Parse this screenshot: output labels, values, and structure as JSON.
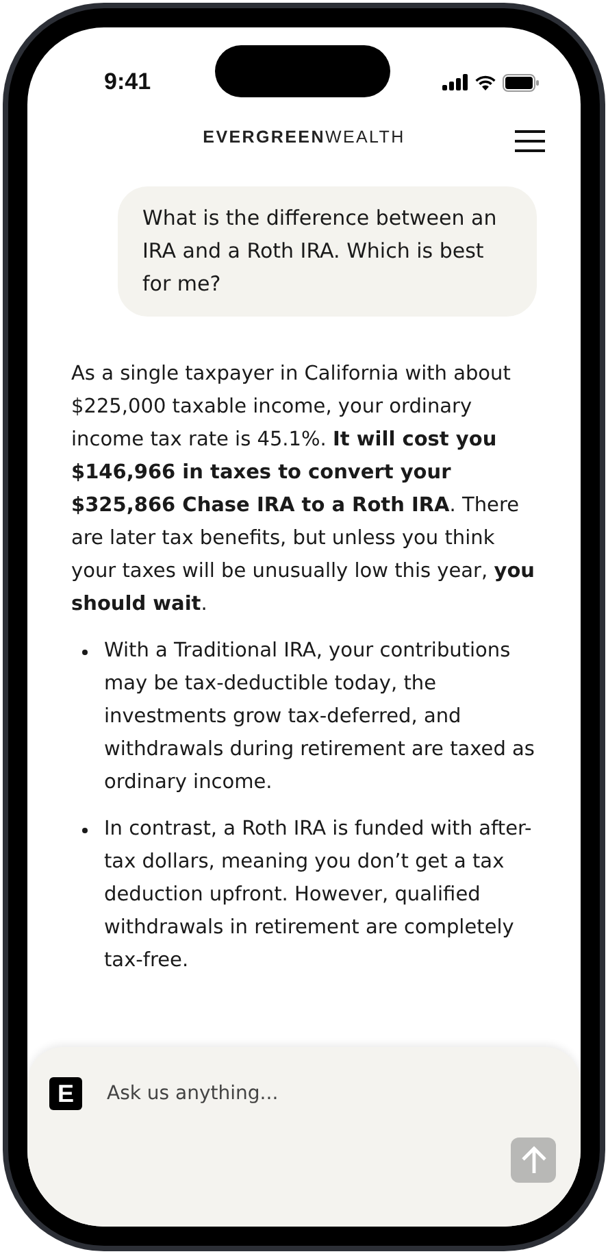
{
  "status_bar": {
    "time": "9:41"
  },
  "header": {
    "brand_bold": "EVERGREEN",
    "brand_light": "WEALTH"
  },
  "messages": [
    {
      "kind": "user",
      "text": "What is the difference between an IRA and a Roth IRA. Which is best for me?"
    },
    {
      "kind": "answer",
      "text": "As a single taxpayer in California with about $225,000 taxable income, your ordinary income tax rate is 45.1%. **It will cost you $146,966 in taxes to convert your $325,866 Chase IRA to a Roth IRA**. There are later tax benefits, but unless you think your taxes will be unusually low this year, **you should wait**.",
      "bullets": [
        "With a Traditional IRA, your contributions may be tax-deductible today, the investments grow tax-deferred, and withdrawals during retirement are taxed as ordinary income.",
        "In contrast, a Roth IRA is funded with after-tax dollars, meaning you don’t get a tax deduction upfront. However, qualified withdrawals in retirement are completely tax-free."
      ]
    }
  ],
  "composer": {
    "logo": "E",
    "placeholder": "Ask us anything...",
    "send_disabled": true
  }
}
